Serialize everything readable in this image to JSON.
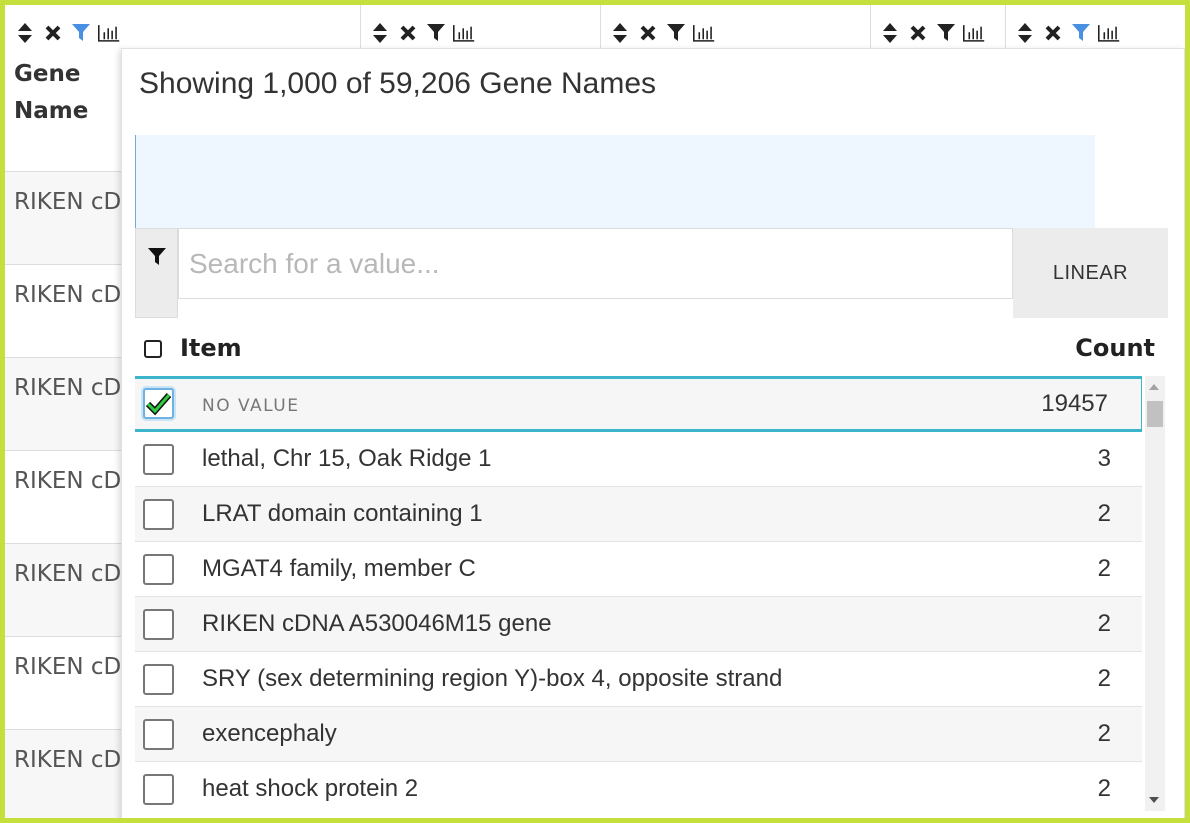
{
  "table": {
    "header_title": "Gene Name",
    "cells": [
      "RIKEN cDNA",
      "RIKEN cDNA",
      "RIKEN cDNA",
      "RIKEN cDNA gene",
      "RIKEN cDNA gene",
      "RIKEN cDNA",
      "RIKEN cDNA"
    ],
    "active_filter_color": "#4a90e2"
  },
  "popup": {
    "title": "Showing 1,000 of 59,206 Gene Names",
    "search_placeholder": "Search for a value...",
    "scale_button": "LINEAR",
    "header_item": "Item",
    "header_count": "Count",
    "items": [
      {
        "label": "NO VALUE",
        "count": "19457",
        "checked": true
      },
      {
        "label": "lethal, Chr 15, Oak Ridge 1",
        "count": "3",
        "checked": false
      },
      {
        "label": "LRAT domain containing 1",
        "count": "2",
        "checked": false
      },
      {
        "label": "MGAT4 family, member C",
        "count": "2",
        "checked": false
      },
      {
        "label": "RIKEN cDNA A530046M15 gene",
        "count": "2",
        "checked": false
      },
      {
        "label": "SRY (sex determining region Y)-box 4, opposite strand",
        "count": "2",
        "checked": false
      },
      {
        "label": "exencephaly",
        "count": "2",
        "checked": false
      },
      {
        "label": "heat shock protein 2",
        "count": "2",
        "checked": false
      }
    ]
  },
  "colors": {
    "border": "#c5e03c",
    "selection": "#3bb5c9",
    "check": "#2ecc40"
  }
}
